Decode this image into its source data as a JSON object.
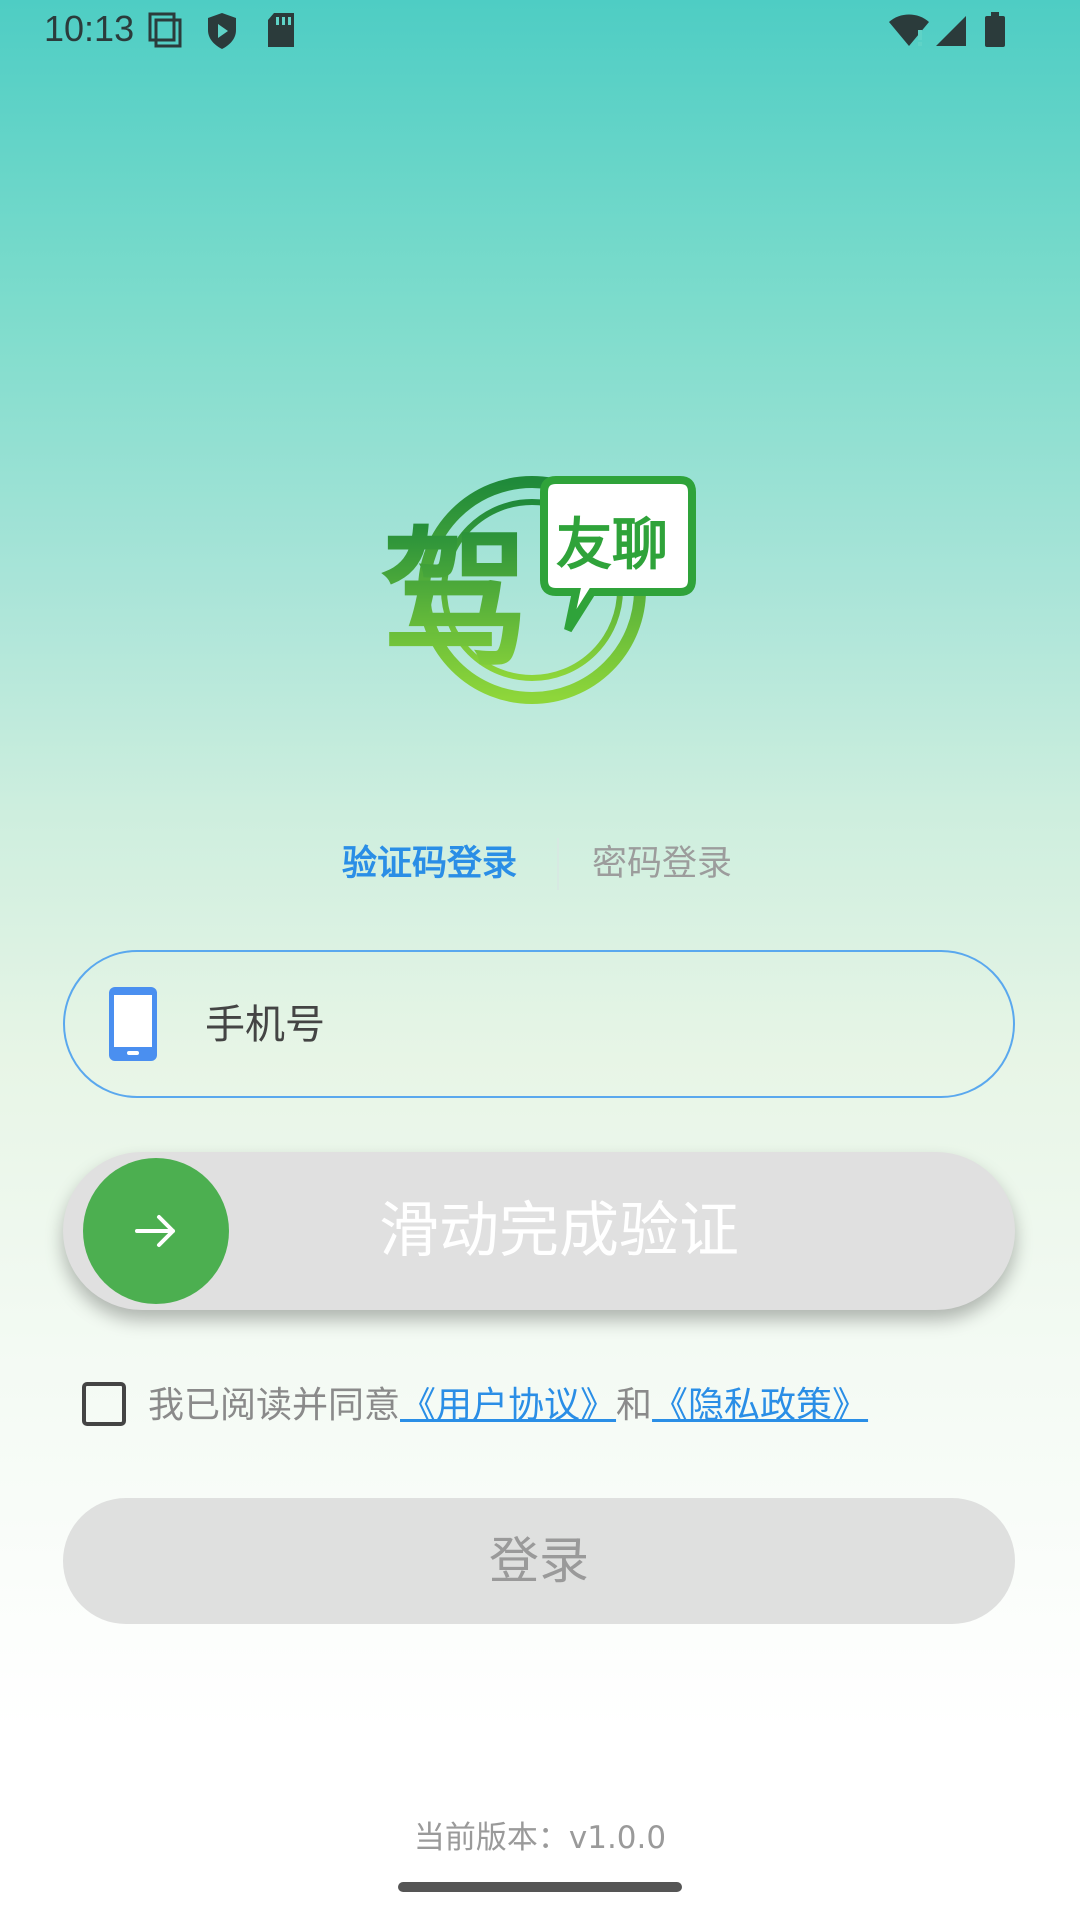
{
  "status_bar": {
    "time": "10:13",
    "icons_left": [
      "screen-record-icon",
      "shield-play-icon",
      "sd-card-icon"
    ],
    "icons_right": [
      "wifi-icon",
      "signal-icon",
      "battery-icon"
    ]
  },
  "logo": {
    "main_char": "驾",
    "bubble_text": "友聊"
  },
  "tabs": {
    "active": "验证码登录",
    "inactive": "密码登录"
  },
  "phone_field": {
    "placeholder": "手机号",
    "icon": "phone-icon"
  },
  "slider": {
    "label": "滑动完成验证",
    "icon": "arrow-right-icon"
  },
  "agreement": {
    "prefix": "我已阅读并同意",
    "user_agreement": "《用户协议》",
    "conjunction": "和",
    "privacy_policy": "《隐私政策》",
    "checked": false
  },
  "login_button": {
    "label": "登录"
  },
  "version": {
    "text": "当前版本：v1.0.0"
  },
  "colors": {
    "accent": "#2a8ee6",
    "slider_handle": "#4caf50",
    "logo_green": "#2fa33a"
  }
}
